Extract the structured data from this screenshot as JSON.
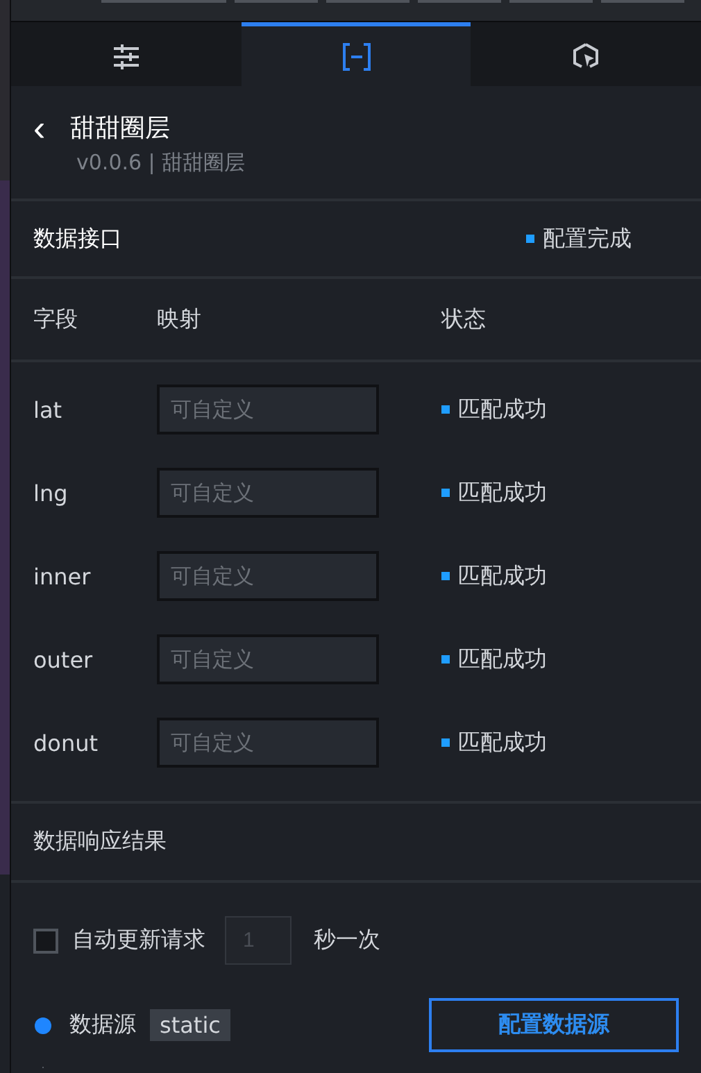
{
  "top_toolbar": {
    "buttons": [
      {
        "kind": "cut"
      },
      {
        "kind": "cut"
      },
      {
        "kind": "cut"
      },
      {
        "kind": "cut"
      },
      {
        "kind": "cut"
      },
      {
        "kind": "cut"
      }
    ]
  },
  "tabs": [
    {
      "kind": "sliders",
      "selected": false
    },
    {
      "kind": "brackets",
      "selected": true
    },
    {
      "kind": "interaction",
      "selected": false
    }
  ],
  "header": {
    "back": "‹",
    "title": "甜甜圈层",
    "subtitle": "v0.0.6 | 甜甜圈层"
  },
  "data_interface": {
    "title": "数据接口",
    "status": "配置完成",
    "color": "#1f9dff"
  },
  "table": {
    "columns": [
      "字段",
      "映射",
      "状态"
    ],
    "rows": [
      {
        "field": "lat",
        "placeholder": "可自定义",
        "status": "匹配成功",
        "color": "#1f9dff"
      },
      {
        "field": "lng",
        "placeholder": "可自定义",
        "status": "匹配成功",
        "color": "#1f9dff"
      },
      {
        "field": "inner",
        "placeholder": "可自定义",
        "status": "匹配成功",
        "color": "#1f9dff"
      },
      {
        "field": "outer",
        "placeholder": "可自定义",
        "status": "匹配成功",
        "color": "#1f9dff"
      },
      {
        "field": "donut",
        "placeholder": "可自定义",
        "status": "匹配成功",
        "color": "#1f9dff"
      }
    ]
  },
  "response": {
    "title": "数据响应结果"
  },
  "auto_update": {
    "checked": false,
    "label": "自动更新请求",
    "interval_placeholder": "1",
    "unit": "秒一次"
  },
  "data_source": {
    "label": "数据源",
    "value": "static",
    "button": "配置数据源"
  }
}
